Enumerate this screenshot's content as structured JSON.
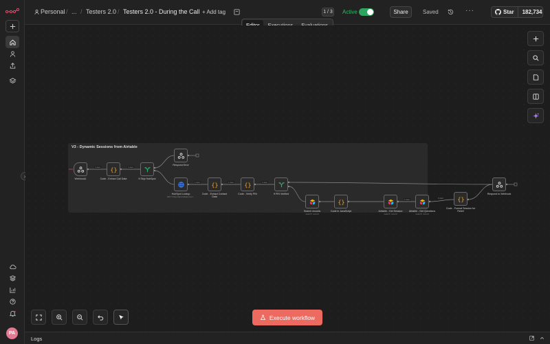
{
  "breadcrumb": {
    "owner": "Personal",
    "ellipsis": "...",
    "folder": "Testers 2.0",
    "workflow": "Testers 2.0 - During the Call",
    "add_tag": "+ Add tag"
  },
  "header": {
    "pager": "1 / 3",
    "active_label": "Active",
    "active": true,
    "share": "Share",
    "saved": "Saved",
    "github_star": "Star",
    "github_count": "182,734"
  },
  "tabs": [
    "Editor",
    "Executions",
    "Evaluations"
  ],
  "selected_tab": "Editor",
  "sticky": {
    "title": "V3 - Dynamic Sessions from Airtable"
  },
  "nodes": {
    "webhook": {
      "label": "Webhook1"
    },
    "code_extract_call": {
      "label": "Code - Extract Call Data"
    },
    "if_skip_hubspot": {
      "label": "If Skip HubSpot"
    },
    "respond_error": {
      "label": "Respond Error"
    },
    "hubspot_lookup": {
      "label": "HubSpot Lookup",
      "sub": "GET: https://api.hubapi.com/..."
    },
    "code_extract_contact": {
      "label": "Code - Extract Contact Data"
    },
    "code_verify_pin": {
      "label": "Code - Verify PIN"
    },
    "if_pin_verified": {
      "label": "If PIN Verified"
    },
    "search_records": {
      "label": "Search records",
      "sub": "search: record"
    },
    "code_js": {
      "label": "Code in JavaScript"
    },
    "airtable_get_session": {
      "label": "Airtable - Get Session",
      "sub": "search: record"
    },
    "airtable_get_questions": {
      "label": "Airtable - Get Questions",
      "sub": "search: record"
    },
    "code_format_session": {
      "label": "Code - Format Session for Retell"
    },
    "respond_webhook": {
      "label": "Respond to Webhook"
    }
  },
  "edge_label": "1 item",
  "execute_button": "Execute workflow",
  "logs": {
    "label": "Logs"
  },
  "colors": {
    "accent": "#ec6a5f",
    "active": "#2ea55f",
    "code": "#f5a623",
    "if": "#25b96a",
    "http": "#4a8cff"
  },
  "icons": {
    "rail": [
      "n8n-logo",
      "plus-icon",
      "home-icon",
      "user-icon",
      "share-icon",
      "layers-icon",
      "cloud-icon",
      "stack-icon",
      "chart-icon",
      "help-icon",
      "bell-icon"
    ],
    "right_tools": [
      "plus-icon",
      "search-icon",
      "note-icon",
      "panel-icon",
      "sparkle-icon"
    ],
    "bottom_tools": [
      "fit-view-icon",
      "zoom-in-icon",
      "zoom-out-icon",
      "undo-icon",
      "pointer-icon"
    ]
  }
}
